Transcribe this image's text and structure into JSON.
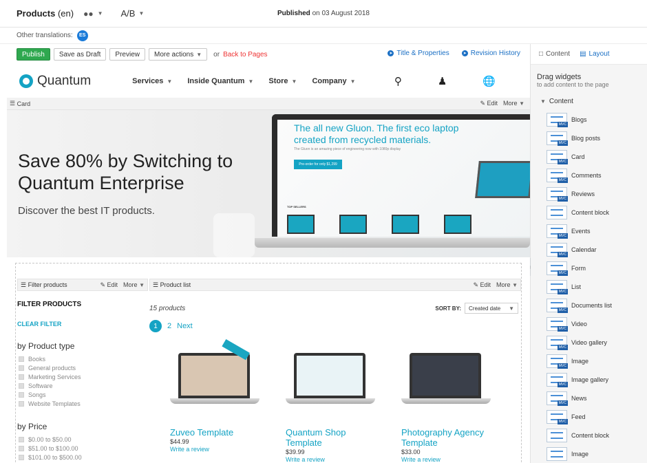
{
  "topbar": {
    "page_title": "Products",
    "language": "(en)",
    "ab_label": "A/B",
    "published_label": "Published",
    "published_date": "on 03 August 2018"
  },
  "translations": {
    "label": "Other translations:",
    "badge": "ES"
  },
  "actions": {
    "publish": "Publish",
    "save_draft": "Save as Draft",
    "preview": "Preview",
    "more_actions": "More actions",
    "or_text": "or",
    "back_to_pages": "Back to Pages",
    "title_properties": "Title & Properties",
    "revision_history": "Revision History"
  },
  "side_tabs": {
    "content": "Content",
    "layout": "Layout"
  },
  "site": {
    "logo": "Quantum",
    "nav": [
      "Services",
      "Inside Quantum",
      "Store",
      "Company"
    ]
  },
  "card_strip": {
    "label": "Card",
    "edit": "Edit",
    "more": "More"
  },
  "hero": {
    "title": "Save 80% by Switching to Quantum Enterprise",
    "subtitle": "Discover the best IT products.",
    "screen_headline": "The all new Gluon. The first eco laptop created from recycled materials.",
    "screen_small": "The Gluon is an amazing piece of engineering now with 1080p display",
    "screen_button": "Pre-order for only $1,299",
    "screen_sellers": "TOP SELLERS"
  },
  "filter": {
    "strip_label": "Filter products",
    "edit": "Edit",
    "more": "More",
    "heading": "FILTER PRODUCTS",
    "clear": "CLEAR FILTER",
    "product_type_title": "by Product type",
    "product_types": [
      "Books",
      "General products",
      "Marketing Services",
      "Software",
      "Songs",
      "Website Templates"
    ],
    "price_title": "by Price",
    "prices": [
      "$0.00 to $50.00",
      "$51.00 to $100.00",
      "$101.00 to $500.00"
    ]
  },
  "product_list": {
    "strip_label": "Product list",
    "edit": "Edit",
    "more": "More",
    "count": "15 products",
    "sort_by": "SORT BY:",
    "sort_value": "Created date",
    "pages": [
      "1",
      "2"
    ],
    "next": "Next",
    "items": [
      {
        "name": "Zuveo Template",
        "price": "$44.99",
        "review": "Write a review",
        "screen_color": "#d9c6b2"
      },
      {
        "name": "Quantum Shop Template",
        "price": "$39.99",
        "review": "Write a review",
        "screen_color": "#e9f3f6"
      },
      {
        "name": "Photography Agency Template",
        "price": "$33.00",
        "review": "Write a review",
        "screen_color": "#3a3f4a"
      }
    ]
  },
  "side_panel": {
    "title": "Drag widgets",
    "subtitle": "to add content to the page",
    "section": "Content",
    "widgets": [
      "Blogs",
      "Blog posts",
      "Card",
      "Comments",
      "Reviews",
      "Content block",
      "Events",
      "Calendar",
      "Form",
      "List",
      "Documents list",
      "Video",
      "Video gallery",
      "Image",
      "Image gallery",
      "News",
      "Feed",
      "Content block",
      "Image"
    ]
  },
  "colors": {
    "accent": "#14a3c4",
    "publish": "#2fa84f",
    "link": "#1a6fc4",
    "danger": "#ee3333"
  }
}
